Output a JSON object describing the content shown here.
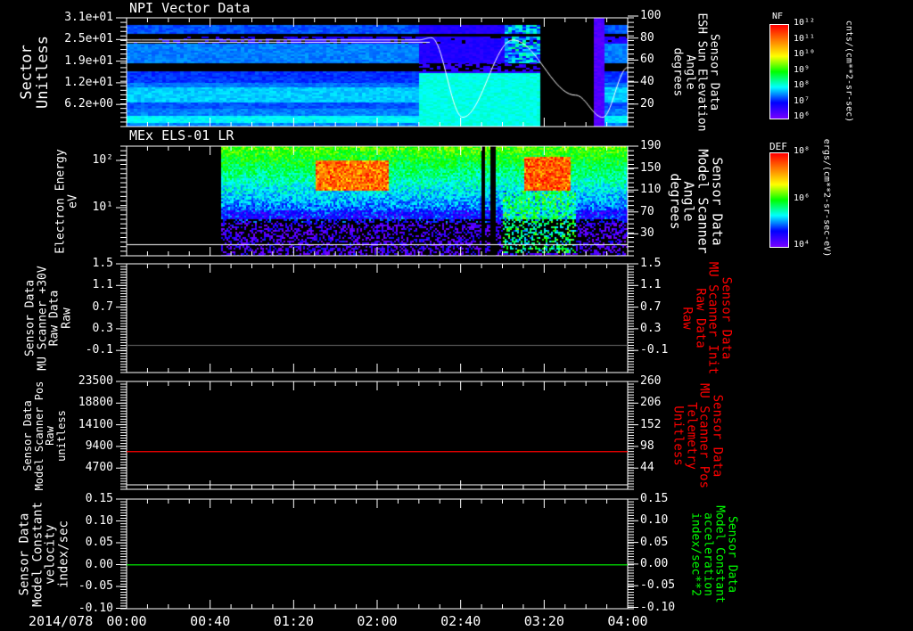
{
  "time_axis": {
    "date": "2014/078",
    "ticks": [
      "00:00",
      "00:40",
      "01:20",
      "02:00",
      "02:40",
      "03:20",
      "04:00"
    ],
    "range_minutes": [
      0,
      240
    ]
  },
  "chart_data": [
    {
      "type": "heatmap",
      "title": "NPI Vector Data",
      "ylabel": [
        "Sector",
        "Unitless"
      ],
      "yticks": [
        "3.1e+01",
        "2.5e+01",
        "1.9e+01",
        "1.2e+01",
        "6.2e+00"
      ],
      "ylim": [
        0,
        31
      ],
      "y2label": [
        "Sensor Data",
        "ESH Sun Elevation",
        "Angle",
        "degrees"
      ],
      "y2ticks": [
        "100",
        "80",
        "60",
        "40",
        "20"
      ],
      "y2lim": [
        0,
        100
      ],
      "overlay_line": {
        "color": "#ffffff",
        "x_minutes": [
          0,
          140,
          146,
          161,
          185,
          215,
          228,
          240
        ],
        "y_degrees": [
          80,
          80,
          82,
          10,
          80,
          30,
          10,
          55
        ]
      },
      "data_gap_minutes": [
        197,
        223
      ],
      "colorbar": {
        "label": "NF",
        "ticks": [
          "10¹²",
          "10¹¹",
          "10¹⁰",
          "10⁹",
          "10⁸",
          "10⁷",
          "10⁶"
        ],
        "units": "cnts/(cm**2-sr-sec)"
      }
    },
    {
      "type": "heatmap",
      "title": "MEx ELS-01 LR",
      "ylabel": [
        "Electron Energy",
        "eV"
      ],
      "yticks": [
        "10²",
        "10¹"
      ],
      "yscale": "log",
      "y2label": [
        "Sensor Data",
        "Model Scanner",
        "Angle",
        "degrees"
      ],
      "y2ticks": [
        "190",
        "150",
        "110",
        "70",
        "30"
      ],
      "y2lim": [
        -10,
        190
      ],
      "data_start_minutes": 45,
      "colorbar": {
        "label": "DEF",
        "ticks": [
          "10⁸",
          "10⁶",
          "10⁴"
        ],
        "units": "ergs/(cm**2-sr-sec-eV)"
      }
    },
    {
      "type": "line",
      "ylabel": [
        "Sensor Data",
        "MU Scanner +30V",
        "Raw Data",
        "Raw"
      ],
      "yticks": [
        "1.5",
        "1.1",
        "0.7",
        "0.3",
        "-0.1"
      ],
      "ylim": [
        -0.5,
        1.5
      ],
      "y2label": [
        "Sensor Data",
        "MU Scanner Init",
        "Raw Data",
        "Raw"
      ],
      "y2ticks": [
        "1.5",
        "1.1",
        "0.7",
        "0.3",
        "-0.1"
      ],
      "series": [
        {
          "color": "#555555",
          "value": 0.0
        }
      ],
      "y2color": "#ff0000"
    },
    {
      "type": "line",
      "ylabel": [
        "Sensor Data",
        "Model Scanner Pos",
        "Raw",
        "unitless"
      ],
      "yticks": [
        "23500",
        "18800",
        "14100",
        "9400",
        "4700"
      ],
      "ylim": [
        0,
        23500
      ],
      "y2label": [
        "Sensor Data",
        "MU Scanner Pos",
        "Telemetry",
        "Unitless"
      ],
      "y2ticks": [
        "260",
        "206",
        "152",
        "98",
        "44"
      ],
      "series": [
        {
          "color": "#ff0000",
          "value": 8200
        }
      ],
      "y2color": "#ff0000"
    },
    {
      "type": "line",
      "ylabel": [
        "Sensor Data",
        "Model Constant",
        "velocity",
        "index/sec"
      ],
      "yticks": [
        "0.15",
        "0.10",
        "0.05",
        "0.00",
        "-0.05",
        "-0.10"
      ],
      "ylim": [
        -0.1,
        0.15
      ],
      "y2label": [
        "Sensor Data",
        "Model Constant",
        "acceleration",
        "index/sec**2"
      ],
      "y2ticks": [
        "0.15",
        "0.10",
        "0.05",
        "0.00",
        "-0.05",
        "-0.10"
      ],
      "series": [
        {
          "color": "#00ff00",
          "value": 0.0
        }
      ],
      "y2color": "#00ff00"
    }
  ]
}
